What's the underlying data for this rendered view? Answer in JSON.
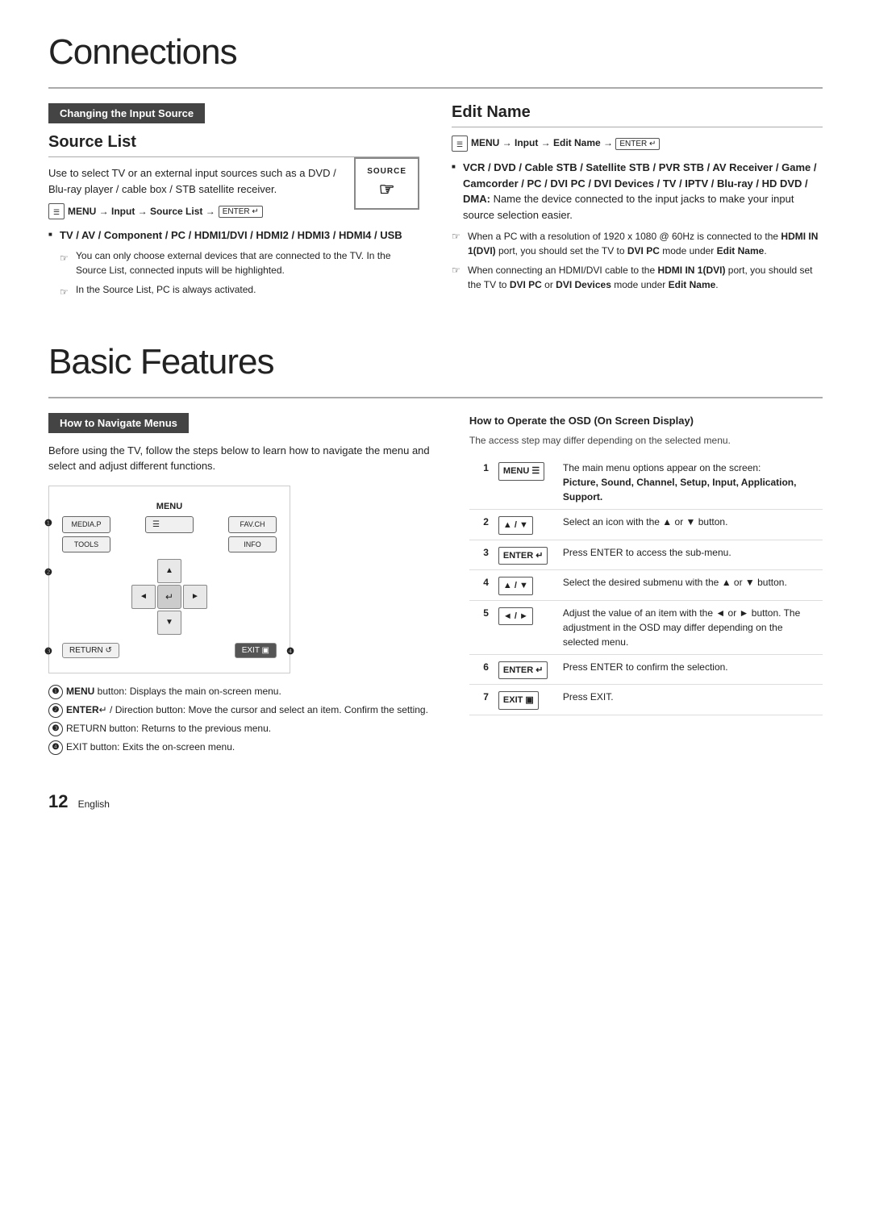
{
  "connections": {
    "title": "Connections",
    "changing_input": {
      "header": "Changing the Input Source"
    },
    "source_list": {
      "heading": "Source List",
      "description": "Use to select TV or an external input sources such as a DVD / Blu-ray player / cable box / STB satellite receiver.",
      "menu_path": "MENU",
      "menu_arrow": "→",
      "menu_item": "Input",
      "menu_item2": "Source List",
      "enter": "ENTER",
      "source_label": "SOURCE",
      "bullet_heading": "TV / AV / Component / PC / HDMI1/DVI / HDMI2 / HDMI3 / HDMI4 / USB",
      "note1": "You can only choose external devices that are connected to the TV. In the Source List, connected inputs will be highlighted.",
      "note2": "In the Source List, PC is always activated."
    },
    "edit_name": {
      "heading": "Edit Name",
      "menu_path": "MENU",
      "menu_item": "Input",
      "menu_item2": "Edit Name",
      "enter": "ENTER",
      "bullet1": "VCR / DVD / Cable STB / Satellite STB / PVR STB / AV Receiver / Game / Camcorder / PC / DVI PC / DVI Devices / TV / IPTV / Blu-ray / HD DVD / DMA:",
      "bullet1_desc": "Name the device connected to the input jacks to make your input source selection easier.",
      "note1": "When a PC with a resolution of 1920 x 1080 @ 60Hz is connected to the HDMI IN 1(DVI) port, you should set the TV to DVI PC mode under Edit Name.",
      "note2": "When connecting an HDMI/DVI cable to the HDMI IN 1(DVI) port, you should set the TV to DVI PC or DVI Devices mode under Edit Name."
    }
  },
  "basic_features": {
    "title": "Basic Features",
    "navigate": {
      "header": "How to Navigate Menus",
      "description": "Before using the TV, follow the steps below to learn how to navigate the menu and select and adjust different functions.",
      "menu_label": "MENU",
      "fav_label": "FAV.CH",
      "tools_label": "TOOLS",
      "info_label": "INFO",
      "return_label": "RETURN",
      "exit_label": "EXIT",
      "btn1_label": "❶",
      "btn2_label": "❷",
      "btn3_label": "❸",
      "btn4_label": "❹",
      "desc1": "MENU button: Displays the main on-screen menu.",
      "desc2": "ENTER / Direction button: Move the cursor and select an item. Confirm the setting.",
      "desc3": "RETURN button: Returns to the previous menu.",
      "desc4": "EXIT button: Exits the on-screen menu."
    },
    "osd": {
      "title": "How to Operate the OSD (On Screen Display)",
      "subtitle": "The access step may differ depending on the selected menu.",
      "rows": [
        {
          "num": "1",
          "key": "MENU",
          "desc": "The main menu options appear on the screen:",
          "desc2": "Picture, Sound, Channel, Setup, Input, Application, Support."
        },
        {
          "num": "2",
          "key": "▲ / ▼",
          "desc": "Select an icon with the ▲ or ▼ button."
        },
        {
          "num": "3",
          "key": "ENTER",
          "desc": "Press ENTER to access the sub-menu."
        },
        {
          "num": "4",
          "key": "▲ / ▼",
          "desc": "Select the desired submenu with the ▲ or ▼ button."
        },
        {
          "num": "5",
          "key": "◄ / ►",
          "desc": "Adjust the value of an item with the ◄ or ► button. The adjustment in the OSD may differ depending on the selected menu."
        },
        {
          "num": "6",
          "key": "ENTER",
          "desc": "Press ENTER to confirm the selection."
        },
        {
          "num": "7",
          "key": "EXIT",
          "desc": "Press EXIT."
        }
      ]
    }
  },
  "page": {
    "number": "12",
    "language": "English"
  }
}
